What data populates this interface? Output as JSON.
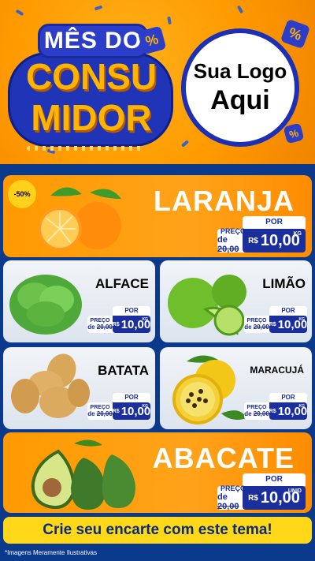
{
  "header": {
    "title_top": "MÊS DO",
    "title_line1": "CONSU",
    "title_line2": "MIDOR",
    "badge_symbol": "%",
    "logo_line1": "Sua Logo",
    "logo_line2": "Aqui"
  },
  "products": [
    {
      "name": "LARANJA",
      "discount": "-50%",
      "por_label": "POR",
      "preco_label": "PREÇO",
      "old_prefix": "de",
      "old_price": "20,00",
      "currency": "R$",
      "price": "10,00",
      "unit": "KG"
    },
    {
      "name": "ALFACE",
      "por_label": "POR",
      "preco_label": "PREÇO",
      "old_prefix": "de",
      "old_price": "20,00",
      "currency": "R$",
      "price": "10,00",
      "unit": "KG"
    },
    {
      "name": "LIMÃO",
      "por_label": "POR",
      "preco_label": "PREÇO",
      "old_prefix": "de",
      "old_price": "20,00",
      "currency": "R$",
      "price": "10,00",
      "unit": "KG"
    },
    {
      "name": "BATATA",
      "por_label": "POR",
      "preco_label": "PREÇO",
      "old_prefix": "de",
      "old_price": "20,00",
      "currency": "R$",
      "price": "10,00",
      "unit": "KG"
    },
    {
      "name": "MARACUJÁ",
      "por_label": "POR",
      "preco_label": "PREÇO",
      "old_prefix": "de",
      "old_price": "20,00",
      "currency": "R$",
      "price": "10,00",
      "unit": "KG"
    },
    {
      "name": "ABACATE",
      "por_label": "POR",
      "preco_label": "PREÇO",
      "old_prefix": "de",
      "old_price": "20,00",
      "currency": "R$",
      "price": "10,00",
      "unit": "UNID"
    }
  ],
  "cta": "Crie seu encarte com este tema!",
  "footnote": "*Imagens Meramente Ilustrativas",
  "icons": [
    "percent-badge-icon",
    "orange-fruit-icon",
    "lettuce-icon",
    "lime-icon",
    "potato-icon",
    "passion-fruit-icon",
    "avocado-icon"
  ],
  "colors": {
    "orange": "#ff9a00",
    "navy": "#1b2f9c",
    "yellow": "#ffd81a",
    "background": "#0b3a8c"
  }
}
